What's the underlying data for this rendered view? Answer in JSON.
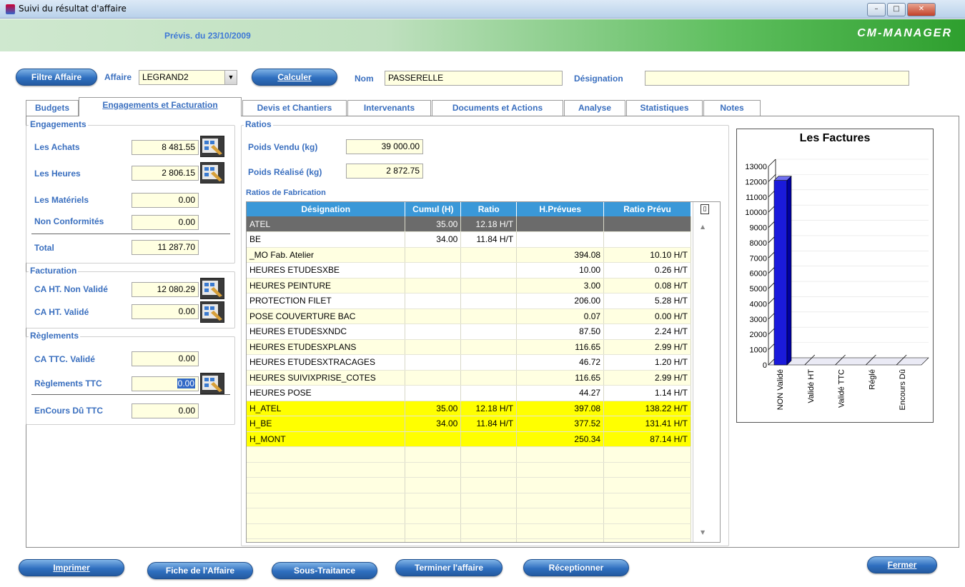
{
  "window": {
    "title": "Suivi du résultat d'affaire",
    "min": "–",
    "max": "□",
    "close": "✕"
  },
  "banner": {
    "previs": "Prévis. du 23/10/2009",
    "brand": "CM-MANAGER"
  },
  "toolbar": {
    "filtre_affaire": "Filtre Affaire",
    "affaire_label": "Affaire",
    "affaire_value": "LEGRAND2",
    "calculer": "Calculer",
    "nom_label": "Nom",
    "nom_value": "PASSERELLE",
    "designation_label": "Désignation",
    "designation_value": ""
  },
  "tabs": [
    "Budgets",
    "Engagements et Facturation",
    "Devis et Chantiers",
    "Intervenants",
    "Documents et Actions",
    "Analyse",
    "Statistiques",
    "Notes"
  ],
  "engagements": {
    "title": "Engagements",
    "achats_label": "Les Achats",
    "achats": "8 481.55",
    "heures_label": "Les Heures",
    "heures": "2 806.15",
    "materiels_label": "Les Matériels",
    "materiels": "0.00",
    "nonconf_label": "Non Conformités",
    "nonconf": "0.00",
    "total_label": "Total",
    "total": "11 287.70"
  },
  "facturation": {
    "title": "Facturation",
    "nonvalide_label": "CA HT. Non Validé",
    "nonvalide": "12 080.29",
    "valide_label": "CA HT. Validé",
    "valide": "0.00"
  },
  "reglements": {
    "title": "Règlements",
    "ttc_label": "CA TTC. Validé",
    "ttc": "0.00",
    "regl_label": "Règlements TTC",
    "regl": "0.00",
    "encours_label": "EnCours Dû TTC",
    "encours": "0.00"
  },
  "ratios": {
    "title": "Ratios",
    "vendu_label": "Poids Vendu (kg)",
    "vendu": "39 000.00",
    "realise_label": "Poids Réalisé (kg)",
    "realise": "2 872.75",
    "fab_title": "Ratios de Fabrication"
  },
  "grid": {
    "columns": [
      "Désignation",
      "Cumul (H)",
      "Ratio",
      "H.Prévues",
      "Ratio Prévu"
    ],
    "rows": [
      {
        "style": "dark",
        "cells": [
          "ATEL",
          "35.00",
          "12.18 H/T",
          "",
          ""
        ]
      },
      {
        "style": "white",
        "cells": [
          "BE",
          "34.00",
          "11.84 H/T",
          "",
          ""
        ]
      },
      {
        "style": "cream",
        "cells": [
          "_MO Fab. Atelier",
          "",
          "",
          "394.08",
          "10.10 H/T"
        ]
      },
      {
        "style": "white",
        "cells": [
          "HEURES ETUDESXBE",
          "",
          "",
          "10.00",
          "0.26 H/T"
        ]
      },
      {
        "style": "cream",
        "cells": [
          "HEURES PEINTURE",
          "",
          "",
          "3.00",
          "0.08 H/T"
        ]
      },
      {
        "style": "white",
        "cells": [
          "PROTECTION FILET",
          "",
          "",
          "206.00",
          "5.28 H/T"
        ]
      },
      {
        "style": "cream",
        "cells": [
          "POSE COUVERTURE BAC",
          "",
          "",
          "0.07",
          "0.00 H/T"
        ]
      },
      {
        "style": "white",
        "cells": [
          "HEURES ETUDESXNDC",
          "",
          "",
          "87.50",
          "2.24 H/T"
        ]
      },
      {
        "style": "cream",
        "cells": [
          "HEURES ETUDESXPLANS",
          "",
          "",
          "116.65",
          "2.99 H/T"
        ]
      },
      {
        "style": "white",
        "cells": [
          "HEURES ETUDESXTRACAGES",
          "",
          "",
          "46.72",
          "1.20 H/T"
        ]
      },
      {
        "style": "cream",
        "cells": [
          "HEURES SUIVIXPRISE_COTES",
          "",
          "",
          "116.65",
          "2.99 H/T"
        ]
      },
      {
        "style": "white",
        "cells": [
          "HEURES POSE",
          "",
          "",
          "44.27",
          "1.14 H/T"
        ]
      },
      {
        "style": "yellow",
        "cells": [
          "H_ATEL",
          "35.00",
          "12.18 H/T",
          "397.08",
          "138.22 H/T"
        ]
      },
      {
        "style": "yellow",
        "cells": [
          "H_BE",
          "34.00",
          "11.84 H/T",
          "377.52",
          "131.41 H/T"
        ]
      },
      {
        "style": "yellow",
        "cells": [
          "H_MONT",
          "",
          "",
          "250.34",
          "87.14 H/T"
        ]
      },
      {
        "style": "empty",
        "cells": [
          "",
          "",
          "",
          "",
          ""
        ]
      },
      {
        "style": "empty",
        "cells": [
          "",
          "",
          "",
          "",
          ""
        ]
      },
      {
        "style": "empty",
        "cells": [
          "",
          "",
          "",
          "",
          ""
        ]
      },
      {
        "style": "empty",
        "cells": [
          "",
          "",
          "",
          "",
          ""
        ]
      },
      {
        "style": "empty",
        "cells": [
          "",
          "",
          "",
          "",
          ""
        ]
      },
      {
        "style": "empty",
        "cells": [
          "",
          "",
          "",
          "",
          ""
        ]
      },
      {
        "style": "empty",
        "cells": [
          "",
          "",
          "",
          "",
          ""
        ]
      }
    ]
  },
  "chart_data": {
    "type": "bar",
    "title": "Les Factures",
    "categories": [
      "NON Validé",
      "Validé HT",
      "Validé TTC",
      "Réglé",
      "Encours Dû"
    ],
    "values": [
      12080.29,
      0,
      0,
      0,
      0
    ],
    "ylim": [
      0,
      13000
    ],
    "yticks": [
      "0",
      "1000",
      "2000",
      "3000",
      "4000",
      "5000",
      "6000",
      "7000",
      "8000",
      "9000",
      "10000",
      "11000",
      "12000",
      "13000"
    ],
    "bar_color": "#1a1adb"
  },
  "bottom": {
    "imprimer": "Imprimer",
    "fiche": "Fiche de l'Affaire",
    "sous": "Sous-Traitance",
    "terminer": "Terminer l'affaire",
    "receptionner": "Réceptionner",
    "fermer": "Fermer"
  }
}
